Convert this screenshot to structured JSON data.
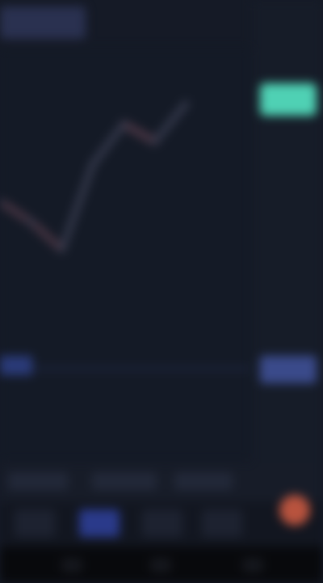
{
  "window": {
    "title": ""
  },
  "toolbar": {
    "symbol_label": ""
  },
  "chart_data": {
    "type": "line",
    "title": "",
    "xlabel": "",
    "ylabel": "",
    "series": [
      {
        "values": [
          0.55,
          0.47,
          0.36,
          0.7,
          0.86,
          0.79,
          0.94
        ]
      }
    ],
    "grid": false,
    "legend": "none"
  },
  "price_axis": {
    "current_price_label": "",
    "line_price_label": ""
  },
  "timeframes": [
    "",
    "",
    ""
  ],
  "bottom_tabs": [
    {
      "label": ""
    },
    {
      "label": "",
      "active": true
    },
    {
      "label": ""
    },
    {
      "label": ""
    },
    {
      "label": ""
    }
  ],
  "colors": {
    "background": "#131722",
    "current_price_tag": "#4fd1b4",
    "price_line": "#3a4a8a",
    "active_tab": "#2a3a8a",
    "avatar": "#b8533e",
    "series_line": "#3a3e52",
    "series_line_highlight": "#4e3846"
  },
  "icons": {
    "system_back": "back-icon",
    "system_home": "home-icon",
    "system_recents": "recents-icon"
  }
}
